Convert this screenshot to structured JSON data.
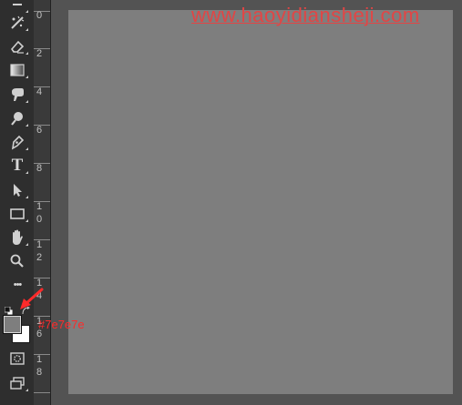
{
  "watermark": {
    "text": "www.haoyidiansheji.com"
  },
  "annotation": {
    "hex_label": "#7e7e7e",
    "arrow_color": "#ff2a2a"
  },
  "ruler": {
    "labels": [
      "0",
      "2",
      "4",
      "6",
      "8",
      "1\n0",
      "1\n2",
      "1\n4",
      "1\n6",
      "1\n8"
    ]
  },
  "colors": {
    "foreground": "#7e7e7e",
    "background": "#ffffff",
    "document_fill": "#7e7e7e",
    "pasteboard": "#535353",
    "toolbar": "#2e2e2e"
  },
  "tools": [
    {
      "id": "move",
      "icon": "move-icon"
    },
    {
      "id": "spot-healing",
      "icon": "spot-healing-brush-icon"
    },
    {
      "id": "eraser",
      "icon": "eraser-icon"
    },
    {
      "id": "gradient",
      "icon": "gradient-icon"
    },
    {
      "id": "smudge",
      "icon": "smudge-icon"
    },
    {
      "id": "dodge",
      "icon": "dodge-icon"
    },
    {
      "id": "pen",
      "icon": "pen-icon"
    },
    {
      "id": "type",
      "icon": "type-icon",
      "glyph": "T"
    },
    {
      "id": "path-selection",
      "icon": "path-selection-icon"
    },
    {
      "id": "rectangle",
      "icon": "rectangle-icon"
    },
    {
      "id": "hand",
      "icon": "hand-icon"
    },
    {
      "id": "zoom",
      "icon": "zoom-icon"
    },
    {
      "id": "more",
      "icon": "more-icon",
      "glyph": "•••"
    },
    {
      "id": "quick-mask",
      "icon": "quick-mask-icon"
    },
    {
      "id": "screen-mode",
      "icon": "screen-mode-icon"
    }
  ]
}
